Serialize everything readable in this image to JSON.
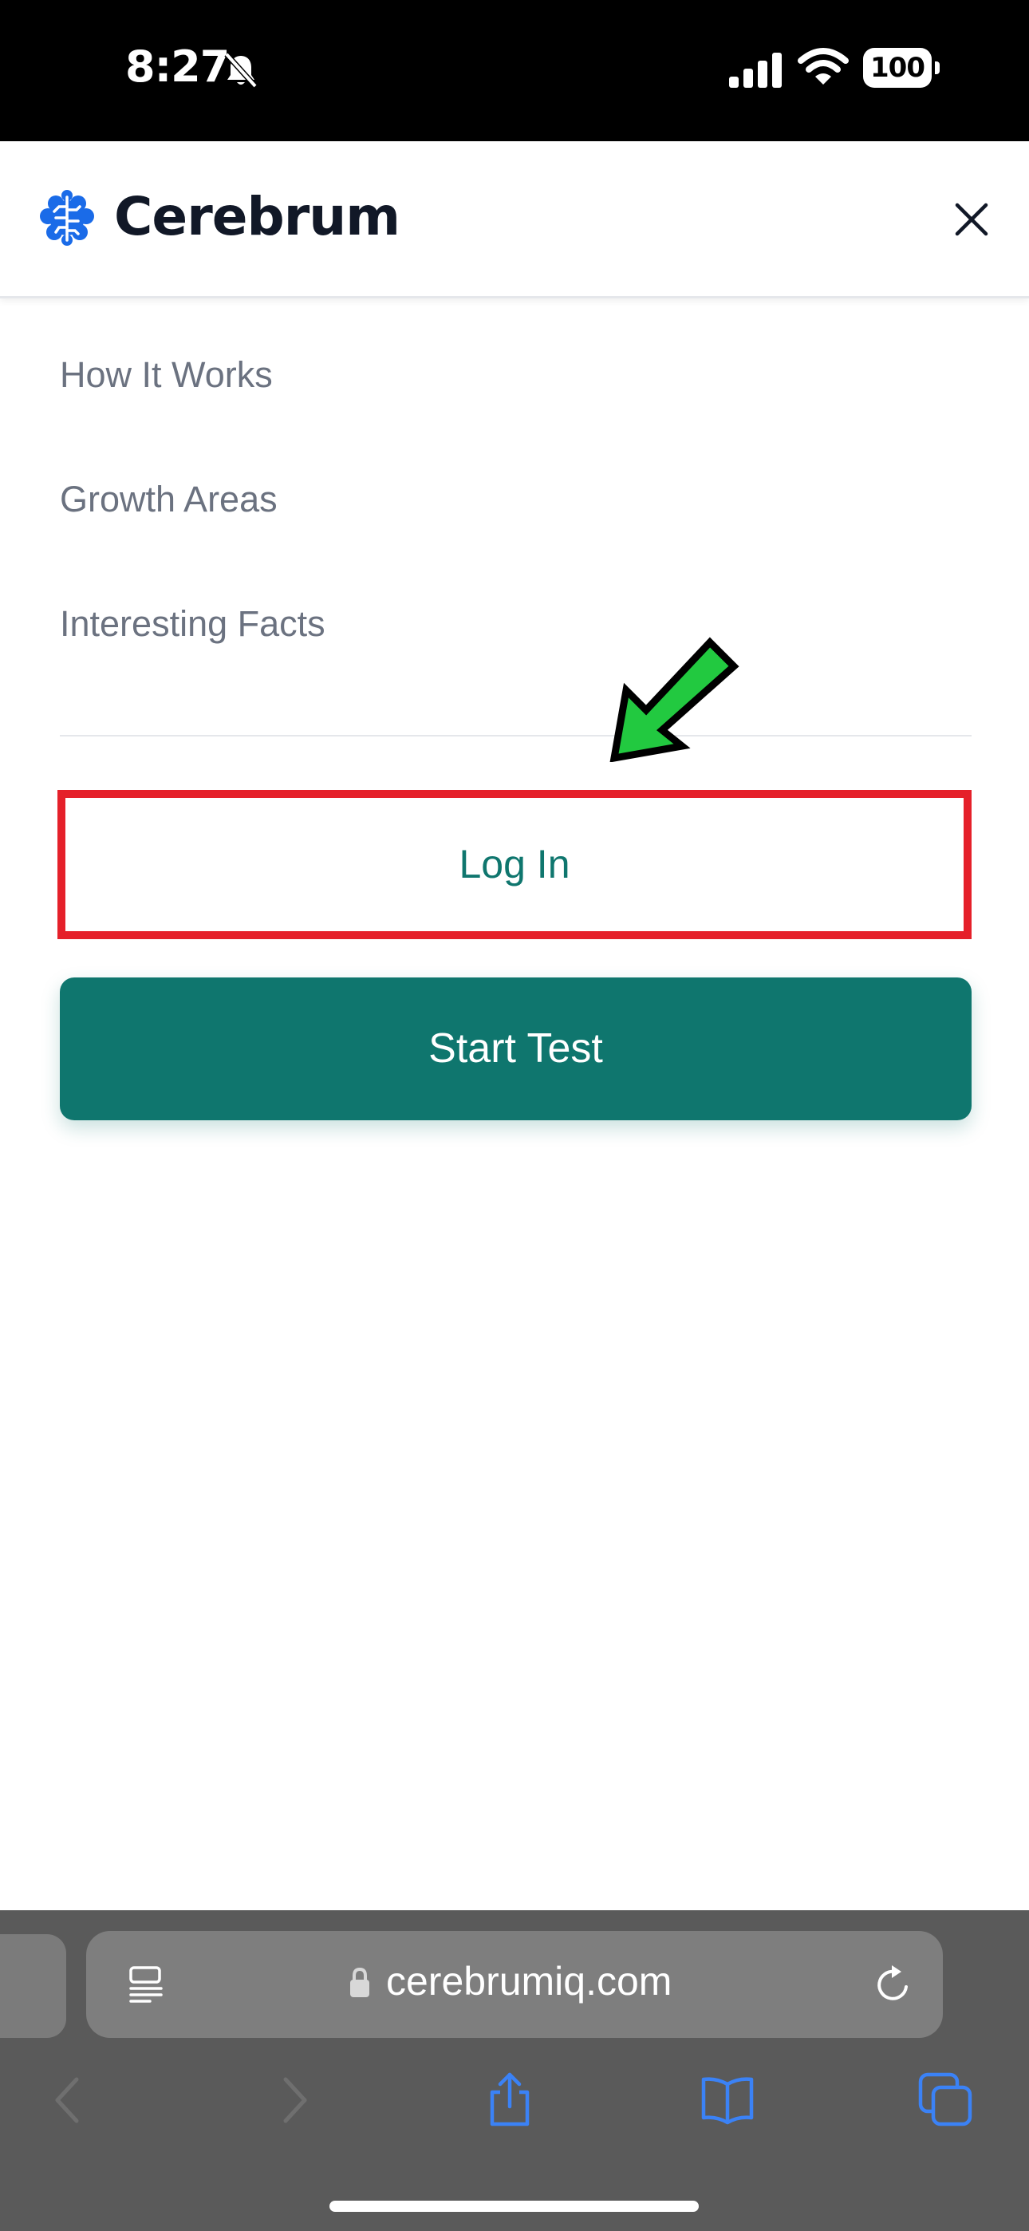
{
  "status_bar": {
    "time": "8:27",
    "battery": "100"
  },
  "header": {
    "brand": "Cerebrum"
  },
  "menu": {
    "items": [
      {
        "label": "How It Works"
      },
      {
        "label": "Growth Areas"
      },
      {
        "label": "Interesting Facts"
      }
    ]
  },
  "actions": {
    "login_label": "Log In",
    "start_label": "Start Test"
  },
  "browser": {
    "url": "cerebrumiq.com"
  },
  "colors": {
    "teal": "#0f766e",
    "highlight_red": "#e5202a",
    "arrow_green": "#22c940",
    "brand_blue": "#1a6be8"
  }
}
